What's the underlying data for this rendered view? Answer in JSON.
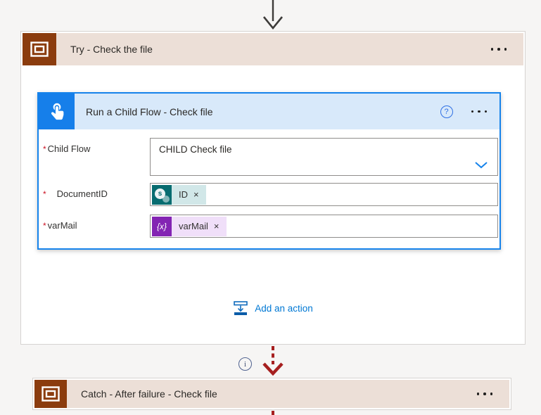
{
  "try_scope": {
    "title": "Try - Check the file"
  },
  "child_flow_card": {
    "title": "Run a Child Flow - Check file",
    "help_icon": "?",
    "add_action_label": "Add an action",
    "fields": {
      "child_flow": {
        "required": "*",
        "label": "Child Flow",
        "value": "CHILD Check file"
      },
      "document_id": {
        "required": "*",
        "label": "DocumentID",
        "token": {
          "label": "ID",
          "remove": "×"
        }
      },
      "var_mail": {
        "required": "*",
        "label": "varMail",
        "token": {
          "label": "varMail",
          "remove": "×"
        }
      }
    }
  },
  "catch_scope": {
    "title": "Catch - After failure - Check file"
  },
  "connectors": {
    "info_label": "i"
  },
  "icons": {
    "variable_token_glyph": "{x}",
    "sharepoint_glyph": "s"
  },
  "colors": {
    "scope_accent": "#8b3c0e",
    "scope_header_bg": "#ecdfd7",
    "child_flow_accent": "#167fea",
    "child_flow_header_bg": "#d8e9fa",
    "selected_card_border": "#1683eb",
    "sharepoint_teal": "#076c70",
    "sharepoint_token_bg": "#d1e7e8",
    "variable_purple": "#8324b3",
    "variable_token_bg": "#f0dff9",
    "failure_arrow_red": "#a61f1f",
    "entry_arrow_gray": "#3d3b39",
    "link_blue": "#0078d4",
    "required_red": "#cb1323"
  }
}
